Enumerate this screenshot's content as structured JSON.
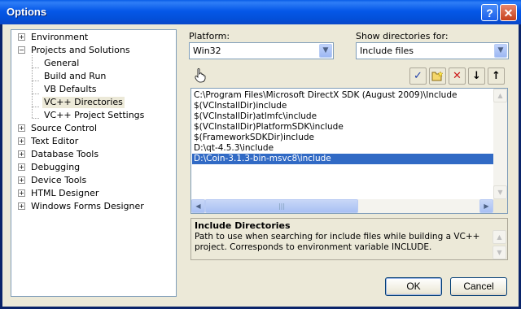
{
  "window": {
    "title": "Options",
    "help_glyph": "?",
    "close_glyph": "✕"
  },
  "tree": {
    "items": [
      {
        "label": "Environment",
        "expander": "+"
      },
      {
        "label": "Projects and Solutions",
        "expander": "−"
      },
      {
        "label": "General"
      },
      {
        "label": "Build and Run"
      },
      {
        "label": "VB Defaults"
      },
      {
        "label": "VC++ Directories"
      },
      {
        "label": "VC++ Project Settings"
      },
      {
        "label": "Source Control",
        "expander": "+"
      },
      {
        "label": "Text Editor",
        "expander": "+"
      },
      {
        "label": "Database Tools",
        "expander": "+"
      },
      {
        "label": "Debugging",
        "expander": "+"
      },
      {
        "label": "Device Tools",
        "expander": "+"
      },
      {
        "label": "HTML Designer",
        "expander": "+"
      },
      {
        "label": "Windows Forms Designer",
        "expander": "+"
      }
    ]
  },
  "platform": {
    "label": "Platform:",
    "value": "Win32"
  },
  "show_dirs": {
    "label": "Show directories for:",
    "value": "Include files"
  },
  "toolbar": {
    "check_glyph": "✓",
    "delete_glyph": "✕",
    "down_glyph": "↓",
    "up_glyph": "↑"
  },
  "directories": [
    "C:\\Program Files\\Microsoft DirectX SDK (August 2009)\\Include",
    "$(VCInstallDir)include",
    "$(VCInstallDir)atlmfc\\include",
    "$(VCInstallDir)PlatformSDK\\include",
    "$(FrameworkSDKDir)include",
    "D:\\qt-4.5.3\\include",
    "D:\\Coin-3.1.3-bin-msvc8\\include"
  ],
  "selected_directory_index": 6,
  "description": {
    "title": "Include Directories",
    "text": "Path to use when searching for include files while building a VC++ project. Corresponds to environment variable INCLUDE."
  },
  "buttons": {
    "ok": "OK",
    "cancel": "Cancel"
  },
  "colors": {
    "selection": "#316ac5",
    "titlebar": "#0558e8",
    "face": "#ece9d8"
  }
}
